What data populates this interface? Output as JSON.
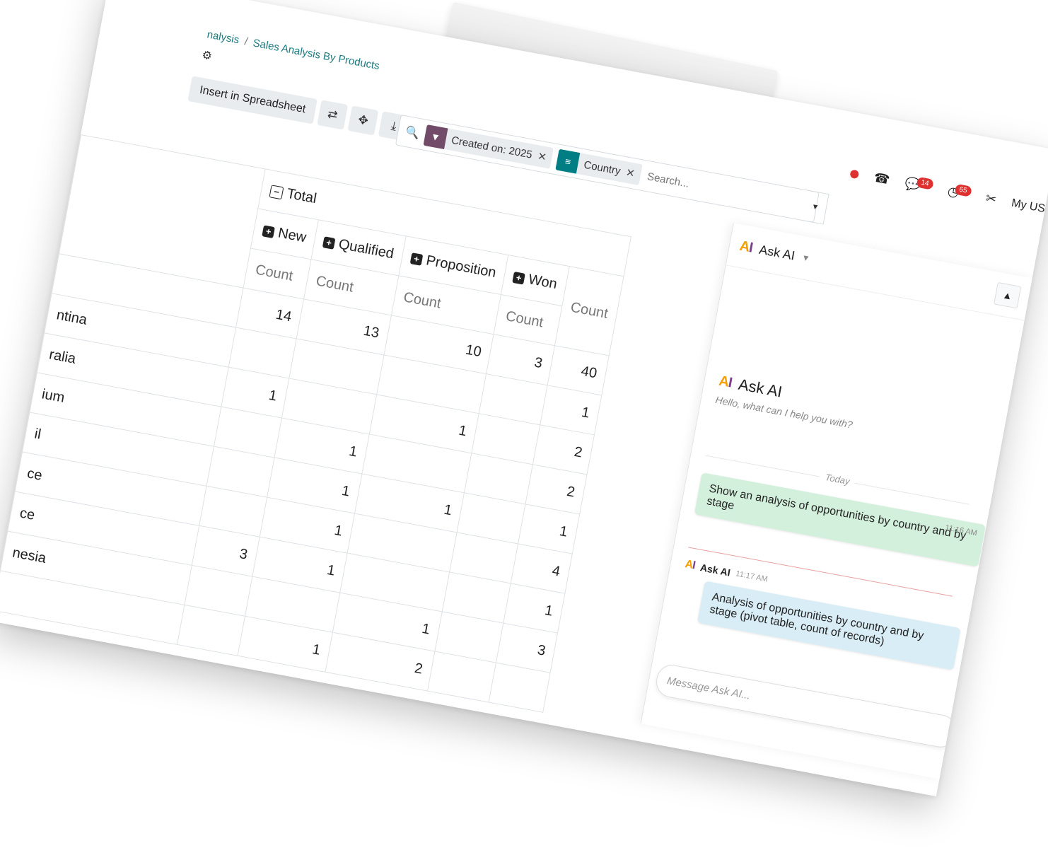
{
  "breadcrumb": {
    "parent": "nalysis",
    "separator": "/",
    "current": "Sales Analysis By Products"
  },
  "toolbar": {
    "insert_label": "Insert in Spreadsheet"
  },
  "search": {
    "facets": [
      {
        "label": "Created on: 2025",
        "color": "#714B67"
      },
      {
        "label": "Country",
        "color": "#017E84"
      }
    ],
    "placeholder": "Search..."
  },
  "systray": {
    "messages_count": "14",
    "activities_count": "65",
    "company": "My US"
  },
  "pivot": {
    "total_header": "Total",
    "stages": [
      "New",
      "Qualified",
      "Proposition",
      "Won"
    ],
    "measure": "Count",
    "totals": [
      "14",
      "13",
      "10",
      "3",
      "40"
    ],
    "rows": [
      {
        "label": "ntina",
        "values": [
          "",
          "",
          "",
          "",
          "1"
        ]
      },
      {
        "label": "ralia",
        "values": [
          "1",
          "",
          "1",
          "",
          "2"
        ]
      },
      {
        "label": "ium",
        "values": [
          "",
          "1",
          "",
          "",
          "2"
        ]
      },
      {
        "label": "il",
        "values": [
          "",
          "1",
          "1",
          "",
          "1"
        ]
      },
      {
        "label": "ce",
        "values": [
          "",
          "1",
          "",
          "",
          "4"
        ]
      },
      {
        "label": "ce",
        "values": [
          "3",
          "1",
          "",
          "",
          "1"
        ]
      },
      {
        "label": "nesia",
        "values": [
          "",
          "",
          "1",
          "",
          "3"
        ]
      },
      {
        "label": "",
        "values": [
          "",
          "1",
          "2",
          "",
          ""
        ]
      }
    ]
  },
  "chat": {
    "title": "Ask AI",
    "welcome_title": "Ask AI",
    "welcome_sub": "Hello, what can I help you with?",
    "day_label": "Today",
    "user_message": "Show an analysis of opportunities by country and by stage",
    "user_time": "11:16 AM",
    "bot_name": "Ask AI",
    "bot_time": "11:17 AM",
    "bot_message": "Analysis of opportunities by country and by stage (pivot table, count of records)",
    "input_placeholder": "Message Ask AI..."
  }
}
